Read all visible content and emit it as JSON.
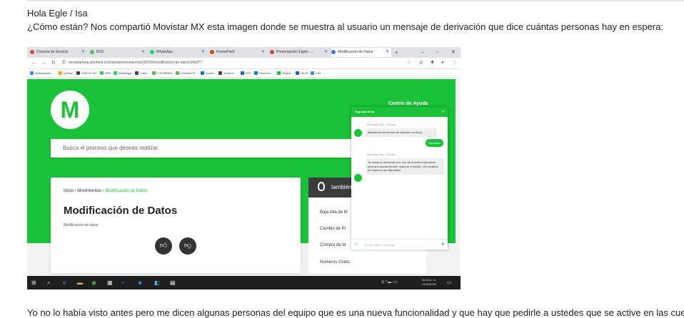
{
  "email": {
    "greeting": "Hola Egle / Isa",
    "question": "¿Cómo están? Nos compartió Movistar MX esta imagen donde se muestra al usuario un mensaje de derivación que dice cuántas personas hay en espera:",
    "footer": "Yo no lo había visto antes pero me dicen algunas personas del equipo que es una nueva funcionalidad y que hay que pedirle a ustedes que se active en las cue"
  },
  "browser": {
    "tabs": [
      {
        "label": "Consola de Servicio",
        "color": "#e24a2b"
      },
      {
        "label": "BSS",
        "color": "#5cb85c"
      },
      {
        "label": "WhatsApp",
        "color": "#25d366"
      },
      {
        "label": "PowerPoint",
        "color": "#d24726"
      },
      {
        "label": "Presentación 9.pptx - ...",
        "color": "#d24726"
      },
      {
        "label": "Modificación de Datos",
        "color": "#3d7bd9"
      }
    ],
    "url": "movistarhelp.alvohelp.com/article/movimientos/36978/modificacion-de-datos/349277",
    "bookmarks": [
      {
        "label": "Aplicaciones",
        "color": "#4285f4"
      },
      {
        "label": "Q-Flow",
        "color": "#f2a900"
      },
      {
        "label": "CHECK IN+",
        "color": "#444"
      },
      {
        "label": "BSS",
        "color": "#5cb85c"
      },
      {
        "label": "WhatsApp",
        "color": "#25d366"
      },
      {
        "label": "Cater",
        "color": "#444"
      },
      {
        "label": "2 SCORING",
        "color": "#5cb85c"
      },
      {
        "label": "Cerrado CF",
        "color": "#5cb85c"
      },
      {
        "label": "Correo",
        "color": "#0078d4"
      },
      {
        "label": "check in",
        "color": "#444"
      },
      {
        "label": "RFC",
        "color": "#1565c0"
      },
      {
        "label": "Ctrol Doc",
        "color": "#0078d4"
      },
      {
        "label": "Payloy",
        "color": "#19c236"
      },
      {
        "label": "HELP",
        "color": "#1565c0"
      },
      {
        "label": "Flot",
        "color": "#4285f4"
      }
    ]
  },
  "site": {
    "logo_letter": "M",
    "help_center": "Centro de Ayuda",
    "search_placeholder": "Busca el proceso que deseas realizar.",
    "breadcrumb": {
      "home": "Inicio",
      "sep": "›",
      "section": "Movimientos",
      "current": "Modificación de Datos"
    },
    "article_title": "Modificación de Datos",
    "article_subtitle": "Modificación de datos",
    "sidebar_title": "también",
    "sidebar_items": [
      "Baja Alta de M",
      "Cambio de Pl",
      "Compra de M",
      "Números Gratis"
    ],
    "brand_green": "#19c236"
  },
  "chat": {
    "header": "Segunda llena",
    "messages": [
      {
        "sender": "Mensaje Help - Mundo",
        "text": "Bienvenido al servicio de atención en línea"
      },
      {
        "sender": "Mensaje Help - Mundo",
        "text": "Te estamos derivando con uno de nuestros ejecutivos para que pueda atender mejor tu consulta. 10) usuarios en espera a ser atendidos"
      }
    ],
    "operator_button": "Operador",
    "input_placeholder": "Escribe aquí tu mensaje"
  },
  "taskbar": {
    "time": "06:42 p. m.",
    "date": "01/06/2020"
  }
}
